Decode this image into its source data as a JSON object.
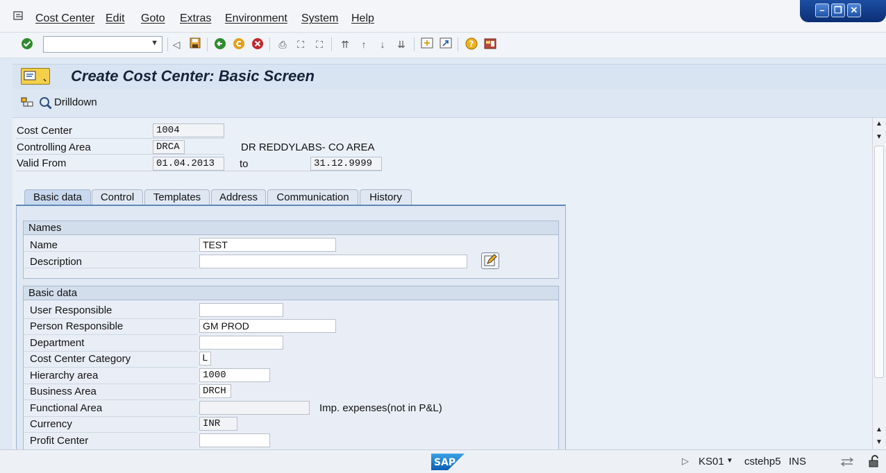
{
  "menu": {
    "items": [
      {
        "label": "Cost Center"
      },
      {
        "label": "Edit"
      },
      {
        "label": "Goto"
      },
      {
        "label": "Extras"
      },
      {
        "label": "Environment"
      },
      {
        "label": "System"
      },
      {
        "label": "Help"
      }
    ]
  },
  "window_controls": {
    "minimize": "minimize-icon",
    "maximize": "maximize-icon",
    "close": "close-icon"
  },
  "toolbar": {
    "command_value": ""
  },
  "page": {
    "title": "Create Cost Center: Basic Screen"
  },
  "appbar": {
    "drilldown_label": "Drilldown"
  },
  "header": {
    "cost_center_label": "Cost Center",
    "cost_center_value": "1004",
    "controlling_area_label": "Controlling Area",
    "controlling_area_value": "DRCA",
    "controlling_area_text": "DR REDDYLABS- CO AREA",
    "valid_from_label": "Valid From",
    "valid_from_value": "01.04.2013",
    "to_label": "to",
    "valid_to_value": "31.12.9999"
  },
  "tabs": [
    {
      "label": "Basic data"
    },
    {
      "label": "Control"
    },
    {
      "label": "Templates"
    },
    {
      "label": "Address"
    },
    {
      "label": "Communication"
    },
    {
      "label": "History"
    }
  ],
  "names_group": {
    "title": "Names",
    "name_label": "Name",
    "name_value": "TEST",
    "description_label": "Description",
    "description_value": ""
  },
  "basic_group": {
    "title": "Basic data",
    "user_responsible_label": "User Responsible",
    "user_responsible_value": "",
    "person_responsible_label": "Person Responsible",
    "person_responsible_value": "GM PROD",
    "department_label": "Department",
    "department_value": "",
    "category_label": "Cost Center Category",
    "category_value": "L",
    "hierarchy_label": "Hierarchy area",
    "hierarchy_value": "1000",
    "business_area_label": "Business Area",
    "business_area_value": "DRCH",
    "functional_area_label": "Functional Area",
    "functional_area_value": "",
    "functional_area_text": "Imp. expenses(not in P&L)",
    "currency_label": "Currency",
    "currency_value": "INR",
    "profit_center_label": "Profit Center",
    "profit_center_value": ""
  },
  "status": {
    "logo": "SAP",
    "transaction": "KS01",
    "server": "cstehp5",
    "mode": "INS"
  },
  "colors": {
    "accent": "#5f87b8",
    "title_bar": "#d8e4f2",
    "window_controls": "#0b2f74"
  }
}
